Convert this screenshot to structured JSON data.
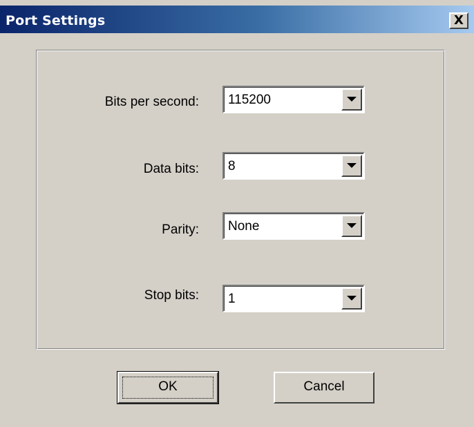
{
  "window": {
    "title": "Port Settings",
    "close_glyph": "X"
  },
  "fields": {
    "bits_per_second": {
      "label": "Bits per second:",
      "value": "115200"
    },
    "data_bits": {
      "label": "Data bits:",
      "value": "8"
    },
    "parity": {
      "label": "Parity:",
      "value": "None"
    },
    "stop_bits": {
      "label": "Stop bits:",
      "value": "1"
    }
  },
  "buttons": {
    "ok": "OK",
    "cancel": "Cancel"
  },
  "icons": {
    "close": "close-icon",
    "dropdown": "chevron-down-icon"
  },
  "colors": {
    "face": "#d4d0c8",
    "title_start": "#0a246a",
    "title_end": "#a6caf0"
  }
}
